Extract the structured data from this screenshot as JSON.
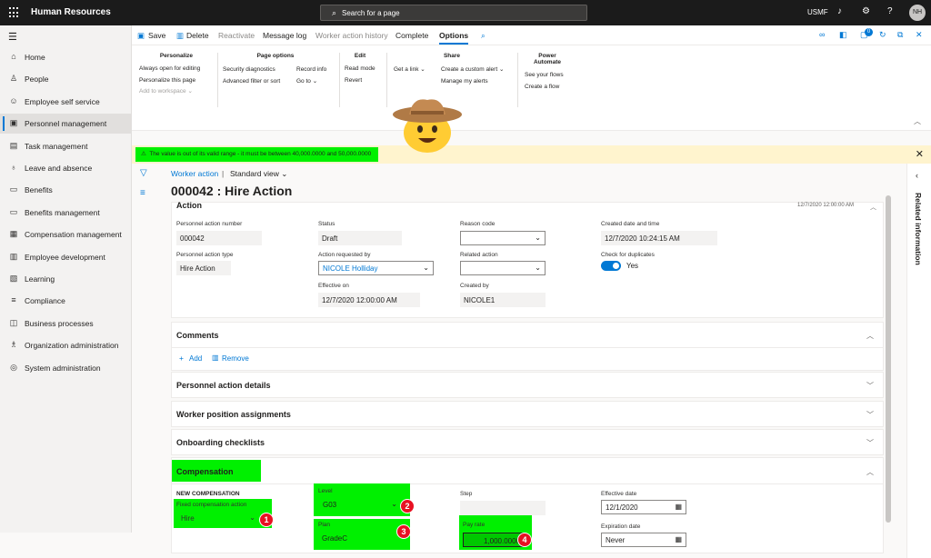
{
  "app": {
    "title": "Human Resources",
    "search_placeholder": "Search for a page",
    "company": "USMF",
    "user_initials": "NH"
  },
  "nav": {
    "items": [
      {
        "label": "Home",
        "icon": "home-icon",
        "glyph": "⌂"
      },
      {
        "label": "People",
        "icon": "people-icon",
        "glyph": "♙"
      },
      {
        "label": "Employee self service",
        "icon": "person-icon",
        "glyph": "☺"
      },
      {
        "label": "Personnel management",
        "icon": "personnel-icon",
        "glyph": "▣"
      },
      {
        "label": "Task management",
        "icon": "clipboard-icon",
        "glyph": "▤"
      },
      {
        "label": "Leave and absence",
        "icon": "leave-icon",
        "glyph": "♁"
      },
      {
        "label": "Benefits",
        "icon": "document-icon",
        "glyph": "▭"
      },
      {
        "label": "Benefits management",
        "icon": "document-icon",
        "glyph": "▭"
      },
      {
        "label": "Compensation management",
        "icon": "compensation-icon",
        "glyph": "▦"
      },
      {
        "label": "Employee development",
        "icon": "development-icon",
        "glyph": "▥"
      },
      {
        "label": "Learning",
        "icon": "learning-icon",
        "glyph": "▧"
      },
      {
        "label": "Compliance",
        "icon": "list-icon",
        "glyph": "≡"
      },
      {
        "label": "Business processes",
        "icon": "process-icon",
        "glyph": "◫"
      },
      {
        "label": "Organization administration",
        "icon": "org-icon",
        "glyph": "♗"
      },
      {
        "label": "System administration",
        "icon": "settings-icon",
        "glyph": "◎"
      }
    ]
  },
  "toolbar": {
    "save": "Save",
    "delete": "Delete",
    "reactivate": "Reactivate",
    "message_log": "Message log",
    "worker_action_history": "Worker action history",
    "complete": "Complete",
    "options": "Options",
    "notification_count": "0"
  },
  "ribbon": {
    "personalize": {
      "header": "Personalize",
      "items": [
        "Always open for editing",
        "Personalize this page",
        "Add to workspace ⌄"
      ]
    },
    "page_options": {
      "header": "Page options",
      "col1": [
        "Security diagnostics",
        "Advanced filter or sort"
      ],
      "col2": [
        "Record info",
        "Go to ⌄"
      ]
    },
    "edit": {
      "header": "Edit",
      "items": [
        "Read mode",
        "Revert"
      ]
    },
    "share": {
      "header": "Share",
      "col1": [
        "Get a link ⌄"
      ],
      "col2": [
        "Create a custom alert ⌄",
        "Manage my alerts"
      ]
    },
    "power_automate": {
      "header": "Power Automate",
      "items": [
        "See your flows",
        "Create a flow"
      ]
    }
  },
  "message": {
    "text": "The value is out of its valid range - it must be between 40,000.0000 and 50,000.0000"
  },
  "page": {
    "breadcrumb": "Worker action",
    "view": "Standard view ⌄",
    "title": "000042 : Hire Action"
  },
  "action": {
    "header": "Action",
    "header_timestamp": "12/7/2020 12:00:00 AM",
    "personnel_action_number_label": "Personnel action number",
    "personnel_action_number": "000042",
    "personnel_action_type_label": "Personnel action type",
    "personnel_action_type": "Hire Action",
    "status_label": "Status",
    "status": "Draft",
    "requested_by_label": "Action requested by",
    "requested_by": "NICOLE Holliday",
    "effective_on_label": "Effective on",
    "effective_on": "12/7/2020 12:00:00 AM",
    "reason_code_label": "Reason code",
    "reason_code": "",
    "related_action_label": "Related action",
    "related_action": "",
    "created_by_label": "Created by",
    "created_by": "NICOLE1",
    "created_datetime_label": "Created date and time",
    "created_datetime": "12/7/2020 10:24:15 AM",
    "check_duplicates_label": "Check for duplicates",
    "check_duplicates": "Yes"
  },
  "comments": {
    "header": "Comments",
    "add": "Add",
    "remove": "Remove"
  },
  "sections": {
    "personnel_action_details": "Personnel action details",
    "worker_position_assignments": "Worker position assignments",
    "onboarding_checklists": "Onboarding checklists"
  },
  "compensation": {
    "header": "Compensation",
    "new_comp_label": "NEW COMPENSATION",
    "fixed_action_label": "Fixed compensation action",
    "fixed_action": "Hire",
    "level_label": "Level",
    "level": "G03",
    "plan_label": "Plan",
    "plan": "GradeC",
    "step_label": "Step",
    "step": "",
    "pay_rate_label": "Pay rate",
    "pay_rate": "1,000.0000",
    "effective_date_label": "Effective date",
    "effective_date": "12/1/2020",
    "expiration_date_label": "Expiration date",
    "expiration_date": "Never",
    "badges": [
      "1",
      "2",
      "3",
      "4"
    ]
  },
  "related_info": "Related information",
  "colors": {
    "accent": "#0078d4",
    "highlight": "#00f000",
    "badge": "#e81123",
    "warning_bg": "#fff4ce"
  }
}
